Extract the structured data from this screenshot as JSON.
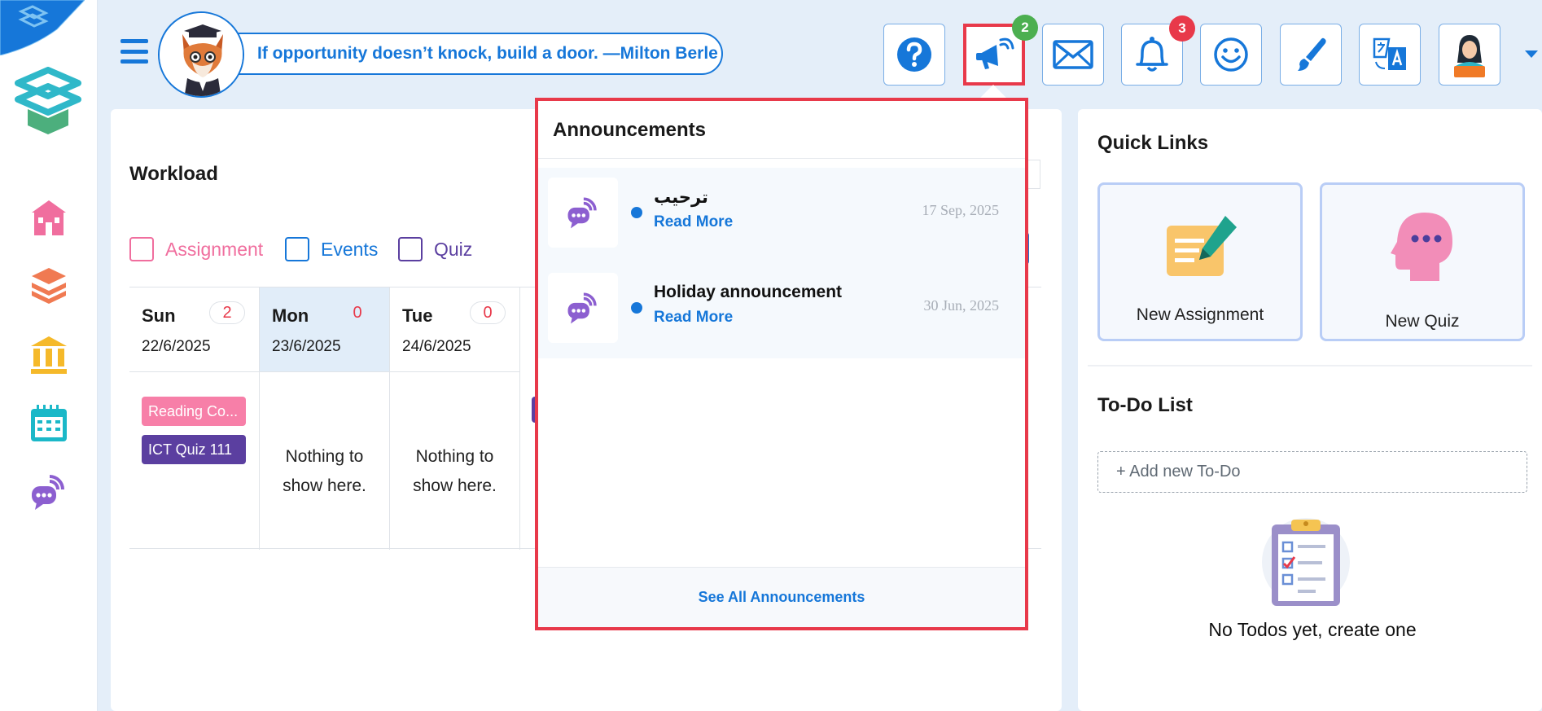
{
  "colors": {
    "primary": "#1677d9",
    "highlight_red": "#e8394a",
    "assignment_pink": "#f06e9e",
    "events_blue": "#1677d9",
    "quiz_purple": "#5b3fa0",
    "badge_green": "#4caf50"
  },
  "header": {
    "quote": "If opportunity doesn’t knock, build a door. —Milton Berle",
    "announcements_badge": "2",
    "notifications_badge": "3"
  },
  "workload": {
    "title": "Workload",
    "legend": [
      {
        "label": "Assignment"
      },
      {
        "label": "Events"
      },
      {
        "label": "Quiz"
      }
    ],
    "days": [
      {
        "name": "Sun",
        "date": "22/6/2025",
        "count": "2"
      },
      {
        "name": "Mon",
        "date": "23/6/2025",
        "count": "0"
      },
      {
        "name": "Tue",
        "date": "24/6/2025",
        "count": "0"
      }
    ],
    "sun_items": [
      {
        "label": "Reading Co..."
      },
      {
        "label": "ICT Quiz 111"
      }
    ],
    "empty_line1": "Nothing to",
    "empty_line2": "show here."
  },
  "announcements": {
    "title": "Announcements",
    "items": [
      {
        "name": "ترحيب",
        "read_more": "Read More",
        "date": "17 Sep, 2025"
      },
      {
        "name": "Holiday announcement",
        "read_more": "Read More",
        "date": "30 Jun, 2025"
      }
    ],
    "see_all": "See All Announcements"
  },
  "quick_links": {
    "title": "Quick Links",
    "items": [
      {
        "label": "New Assignment"
      },
      {
        "label": "New Quiz"
      }
    ]
  },
  "todo": {
    "title": "To-Do List",
    "placeholder": "+ Add new To-Do",
    "empty_message": "No Todos yet, create one"
  }
}
